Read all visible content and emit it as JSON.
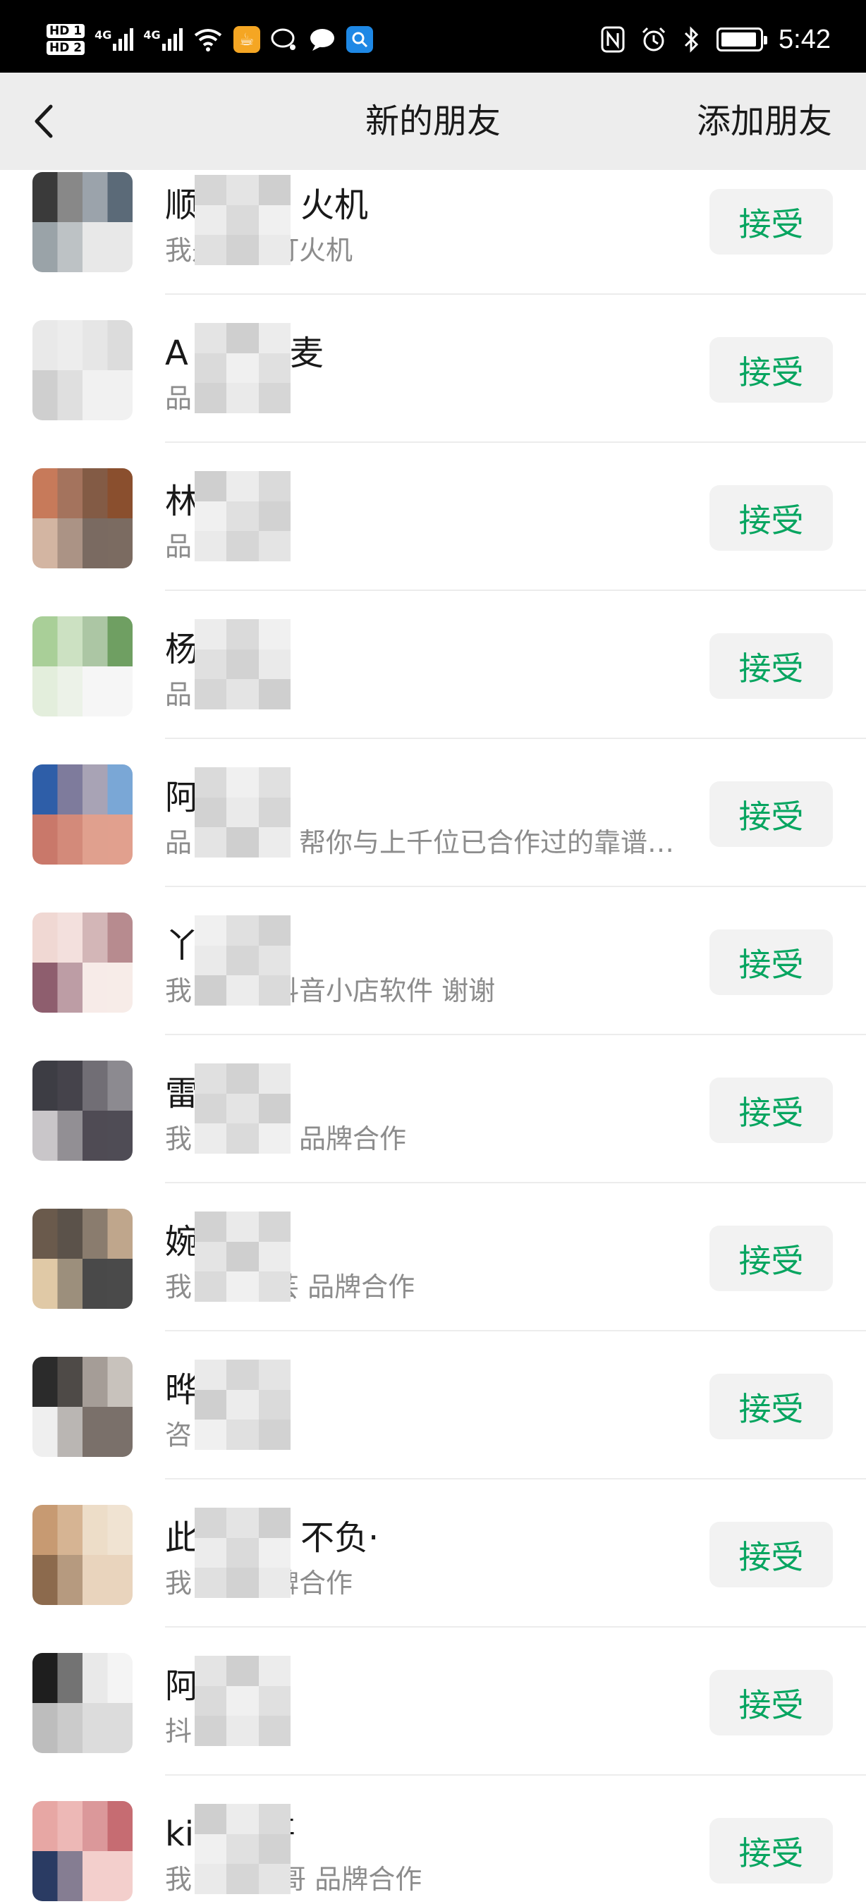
{
  "status_bar": {
    "hd_top": "HD 1",
    "hd_bottom": "HD 2",
    "net1": "4G",
    "net2": "4G",
    "time": "5:42",
    "icons": [
      "signal-icon",
      "wifi-icon",
      "app-icon",
      "chat-bubble-icon",
      "message-icon",
      "search-app-icon",
      "nfc-icon",
      "alarm-icon",
      "bluetooth-icon",
      "battery-icon"
    ],
    "battery_level": 0.9
  },
  "nav": {
    "title": "新的朋友",
    "action": "添加朋友",
    "back_icon": "chevron-left-icon"
  },
  "accept_color": "#07a560",
  "requests": [
    {
      "name": "顺　　　火机",
      "desc": "我是　　打火机",
      "accept": "接受",
      "avatar_colors": [
        "#3a3a3a",
        "#5b6a78",
        "#9aa3a8",
        "#e8e8e8"
      ]
    },
    {
      "name": "A　　　麦",
      "desc": "品",
      "accept": "接受",
      "avatar_colors": [
        "#e9e9e9",
        "#dcdcdc",
        "#cfcfcf",
        "#f1f1f1"
      ]
    },
    {
      "name": "林",
      "desc": "品",
      "accept": "接受",
      "avatar_colors": [
        "#c77a5a",
        "#8a4f2e",
        "#d3b5a2",
        "#7b6b61"
      ]
    },
    {
      "name": "杨",
      "desc": "品",
      "accept": "接受",
      "avatar_colors": [
        "#a9cf98",
        "#6f9f62",
        "#e3eedc",
        "#f6f6f6"
      ]
    },
    {
      "name": "阿",
      "desc": "品　　　，帮你与上千位已合作过的靠谱达人建立联系",
      "accept": "接受",
      "avatar_colors": [
        "#2e5ea8",
        "#7aa7d6",
        "#c9786a",
        "#e1a08e"
      ]
    },
    {
      "name": "丫",
      "desc": "我　　　抖音小店软件 谢谢",
      "accept": "接受",
      "avatar_colors": [
        "#f0d8d3",
        "#b78b8f",
        "#8e5e6e",
        "#f7ece8"
      ]
    },
    {
      "name": "雷",
      "desc": "我　　　，品牌合作",
      "accept": "接受",
      "avatar_colors": [
        "#3d3d44",
        "#8c8a90",
        "#c9c6c9",
        "#4f4c55"
      ]
    },
    {
      "name": "婉",
      "desc": "我　　　芸 品牌合作",
      "accept": "接受",
      "avatar_colors": [
        "#6a5a4c",
        "#bfa68c",
        "#e0c9a6",
        "#4a4a4a"
      ]
    },
    {
      "name": "晔",
      "desc": "咨　　店",
      "accept": "接受",
      "avatar_colors": [
        "#2b2b2b",
        "#c8c2bc",
        "#efefef",
        "#7a706a"
      ]
    },
    {
      "name": "此　　　不负·",
      "desc": "我　　品牌合作",
      "accept": "接受",
      "avatar_colors": [
        "#c79a72",
        "#f0e3d2",
        "#8c6a4d",
        "#e9d4bd"
      ]
    },
    {
      "name": "阿",
      "desc": "抖",
      "accept": "接受",
      "avatar_colors": [
        "#1e1e1e",
        "#f4f4f4",
        "#bdbdbd",
        "#dcdcdc"
      ]
    },
    {
      "name": "ki　　哥",
      "desc": "我　　ng哥 品牌合作",
      "accept": "接受",
      "avatar_colors": [
        "#e7a7a4",
        "#c66c72",
        "#2a3b63",
        "#f3cfcc"
      ]
    }
  ]
}
